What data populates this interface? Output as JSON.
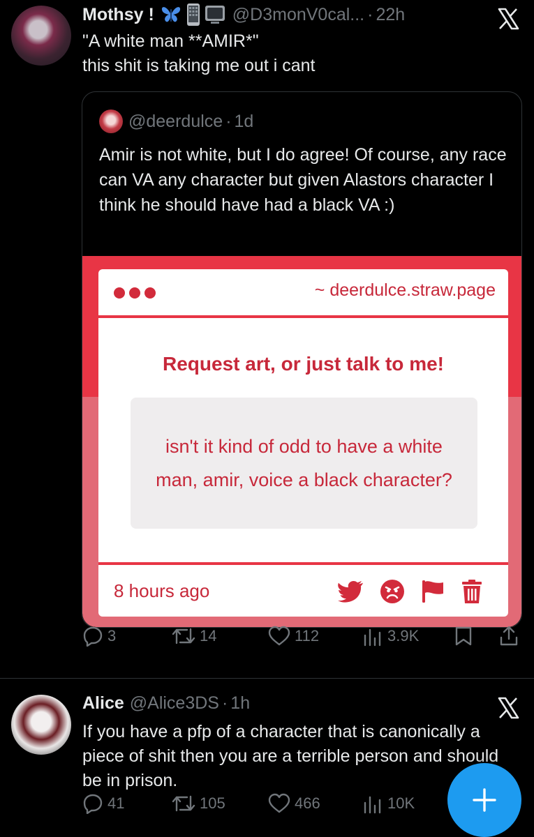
{
  "colors": {
    "accent": "#1d9bf0",
    "muted": "#71767b",
    "card_red": "#e83545",
    "card_text": "#c7283a"
  },
  "tweet1": {
    "name": "Mothsy !",
    "emojis": [
      "butterfly-icon",
      "phone-icon",
      "tv-icon"
    ],
    "handle": "@D3monV0cal...",
    "dot": "·",
    "time": "22h",
    "line1": "\"A white man **AMIR*\"",
    "line2": "this shit is taking me out i cant",
    "quote": {
      "handle": "@deerdulce",
      "dot": "·",
      "time": "1d",
      "text": "Amir is not white, but I do agree! Of course, any race can VA any character but given Alastors character I think he should have had a black VA :)",
      "card": {
        "url": "~ deerdulce.straw.page",
        "title": "Request art, or just talk to me!",
        "message": "isn't it kind of odd to have a white man, amir, voice a black character?",
        "ago": "8 hours ago",
        "icons": [
          "bird-icon",
          "angry-face-icon",
          "flag-icon",
          "trash-icon"
        ]
      }
    },
    "actions": {
      "replies": "3",
      "retweets": "14",
      "likes": "112",
      "views": "3.9K"
    }
  },
  "tweet2": {
    "name": "Alice",
    "handle": "@Alice3DS",
    "dot": "·",
    "time": "1h",
    "text": "If you have a pfp of a character that is canonically a piece of shit then you are a terrible person and should be in prison.",
    "actions": {
      "replies": "41",
      "retweets": "105",
      "likes": "466",
      "views": "10K"
    }
  },
  "fab": {
    "icon": "plus-icon"
  }
}
